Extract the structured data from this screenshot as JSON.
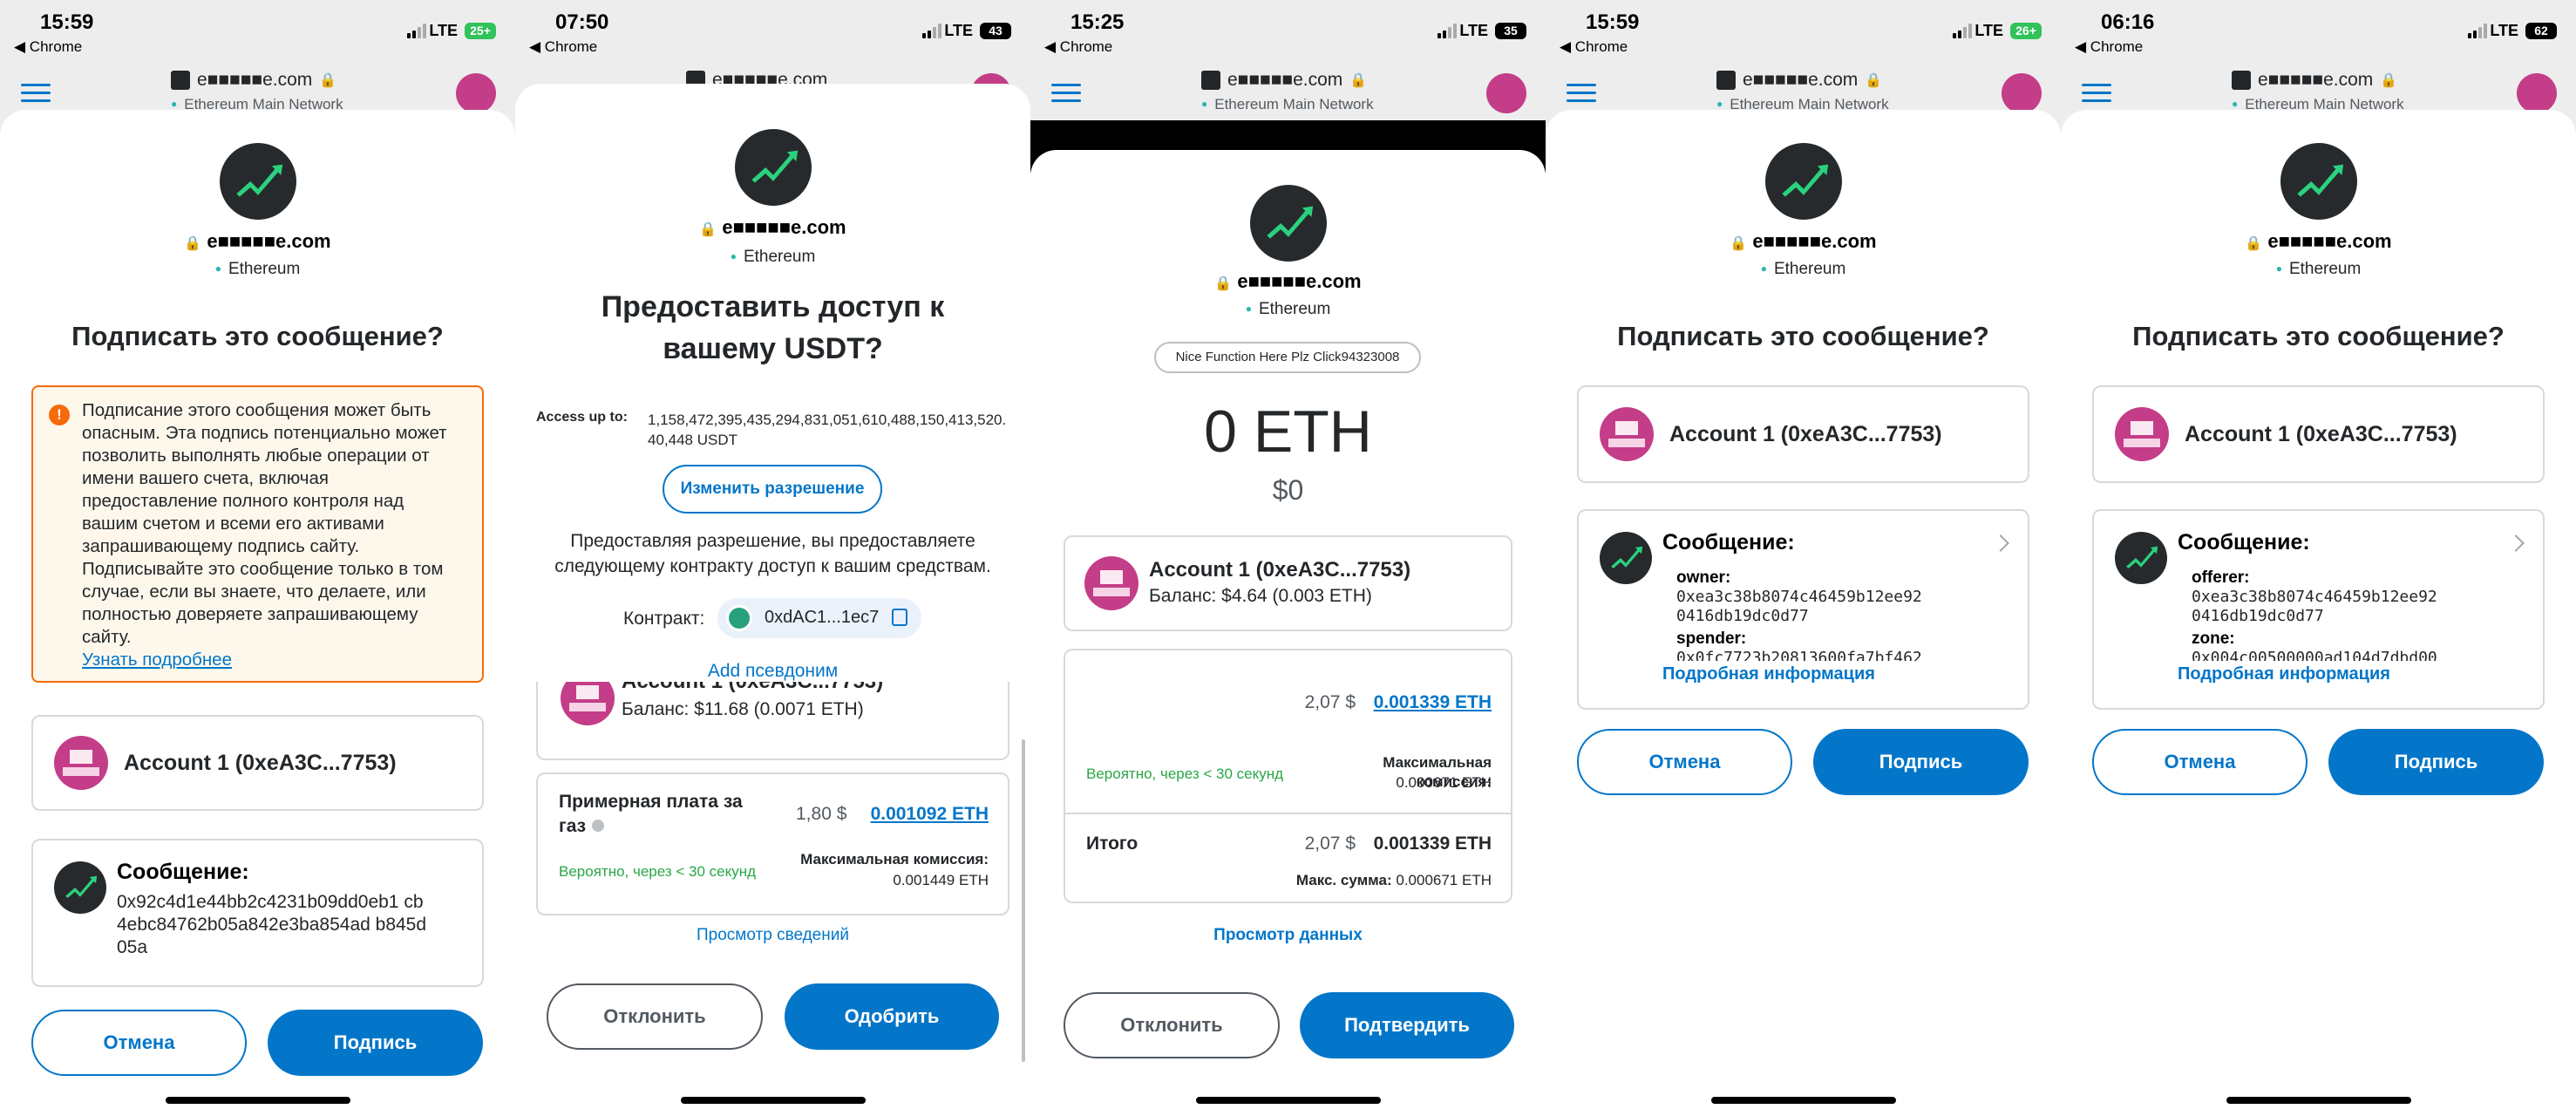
{
  "panels": [
    {
      "time": "15:59",
      "back": "◀ Chrome",
      "lte": "LTE",
      "battery": "25+",
      "battery_color": "#31c25a",
      "url": "e■■■■■e.com",
      "network_bar": "Ethereum Main Network",
      "site": "e■■■■■e.com",
      "network": "Ethereum",
      "title": "Подписать это сообщение?",
      "warning": "Подписание этого сообщения может быть опасным. Эта подпись потенциально может позволить выполнять любые операции от имени вашего счета, включая предоставление полного контроля над вашим счетом и всеми его активами запрашивающему подпись сайту. Подписывайте это сообщение только в том случае, если вы знаете, что делаете, или полностью доверяете запрашивающему сайту.",
      "warning_link": "Узнать подробнее",
      "account": "Account 1 (0xeA3C...7753)",
      "message_label": "Сообщение:",
      "message_hash": "0x92c4d1e44bb2c4231b09dd0eb1 cb4ebc84762b05a842e3ba854ad b845d05a",
      "cancel": "Отмена",
      "sign": "Подпись"
    },
    {
      "time": "07:50",
      "back": "◀ Chrome",
      "lte": "LTE",
      "battery": "43",
      "battery_color": "#000000",
      "url": "e■■■■■e.com",
      "site": "e■■■■■e.com",
      "network": "Ethereum",
      "title": "Предоставить доступ к вашему USDT?",
      "access_label": "Access up to:",
      "access_value": "1,158,472,395,435,294,831,051,610,488,150,413,520.40,448 USDT",
      "edit_permission": "Изменить разрешение",
      "grant_text": "Предоставляя разрешение, вы предоставляете следующему контракту доступ к вашим средствам.",
      "contract_label": "Контракт:",
      "contract_addr": "0xdAC1...1ec7",
      "add_alias": "Add псевдоним",
      "account_partial": "Account 1 (0xeA3C...7753)",
      "balance": "Баланс: $11.68 (0.0071 ETH)",
      "gas_label": "Примерная плата за газ",
      "gas_usd": "1,80 $",
      "gas_eth": "0.001092 ETH",
      "likely": "Вероятно, через < 30 секунд",
      "max_fee_label": "Максимальная комиссия:",
      "max_fee": "0.001449 ETH",
      "view_details": "Просмотр сведений",
      "reject": "Отклонить",
      "approve": "Одобрить"
    },
    {
      "time": "15:25",
      "back": "◀ Chrome",
      "lte": "LTE",
      "battery": "35",
      "battery_color": "#000000",
      "url": "e■■■■■e.com",
      "network_bar": "Ethereum Main Network",
      "site": "e■■■■■e.com",
      "network": "Ethereum",
      "func_pill": "Nice Function Here Plz Click94323008",
      "amount": "0 ETH",
      "amount_usd": "$0",
      "account": "Account 1 (0xeA3C...7753)",
      "balance": "Баланс: $4.64 (0.003 ETH)",
      "fee_usd": "2,07 $",
      "fee_eth": "0.001339 ETH",
      "likely": "Вероятно, через < 30 секунд",
      "max_fee_label": "Максимальная комиссия:",
      "max_fee": "0.000671 ETH",
      "total_label": "Итого",
      "total_usd": "2,07 $",
      "total_eth": "0.001339 ETH",
      "max_sum_label": "Макс. сумма:",
      "max_sum": "0.000671 ETH",
      "view_data": "Просмотр данных",
      "reject": "Отклонить",
      "confirm": "Подтвердить"
    },
    {
      "time": "15:59",
      "back": "◀ Chrome",
      "lte": "LTE",
      "battery": "26+",
      "battery_color": "#31c25a",
      "url": "e■■■■■e.com",
      "network_bar": "Ethereum Main Network",
      "site": "e■■■■■e.com",
      "network": "Ethereum",
      "title": "Подписать это сообщение?",
      "account": "Account 1 (0xeA3C...7753)",
      "message_label": "Сообщение:",
      "field1_label": "owner:",
      "field1_value": "0xea3c38b8074c46459b12ee92 0416db19dc0d77",
      "field2_label": "spender:",
      "field2_value": "0x0fc7723b20813600fa7bf462",
      "more_info": "Подробная информация",
      "cancel": "Отмена",
      "sign": "Подпись"
    },
    {
      "time": "06:16",
      "back": "◀ Chrome",
      "lte": "LTE",
      "battery": "62",
      "battery_color": "#000000",
      "url": "e■■■■■e.com",
      "network_bar": "Ethereum Main Network",
      "site": "e■■■■■e.com",
      "network": "Ethereum",
      "title": "Подписать это сообщение?",
      "account": "Account 1 (0xeA3C...7753)",
      "message_label": "Сообщение:",
      "field1_label": "offerer:",
      "field1_value": "0xea3c38b8074c46459b12ee92 0416db19dc0d77",
      "field2_label": "zone:",
      "field2_value": "0x004c00500000ad104d7dbd00",
      "more_info": "Подробная информация",
      "cancel": "Отмена",
      "sign": "Подпись"
    }
  ]
}
